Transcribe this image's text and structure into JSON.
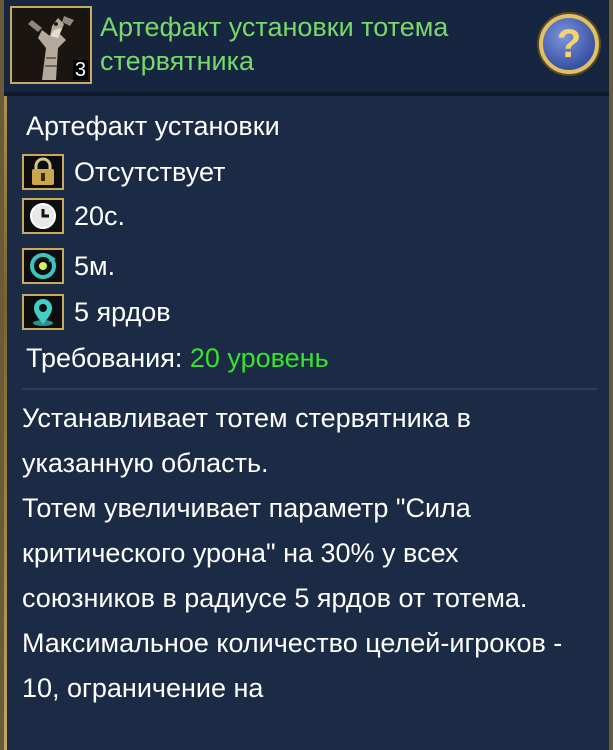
{
  "header": {
    "title": "Артефакт установки тотема стервятника",
    "count": "3",
    "help_symbol": "?"
  },
  "item_type": "Артефакт установки",
  "stats": [
    {
      "icon": "lock-icon",
      "text": "Отсутствует"
    },
    {
      "icon": "clock-icon",
      "text": "20с."
    },
    {
      "icon": "cooldown-icon",
      "text": "5м."
    },
    {
      "icon": "location-pin-icon",
      "text": "5 ярдов"
    }
  ],
  "requirements": {
    "label": "Требования: ",
    "value": "20 уровень"
  },
  "description": [
    "Устанавливает тотем стервятника в указанную область.",
    "Тотем увеличивает параметр \"Сила критического урона\" на 30% у всех союзников в радиусе 5 ярдов от тотема.",
    "Максимальное количество целей-игроков - 10, ограничение на"
  ],
  "colors": {
    "title": "#79d86a",
    "requirement_value": "#35e42a",
    "panel_background": "#1b2a45",
    "gold_border": "#c9aa5b"
  }
}
